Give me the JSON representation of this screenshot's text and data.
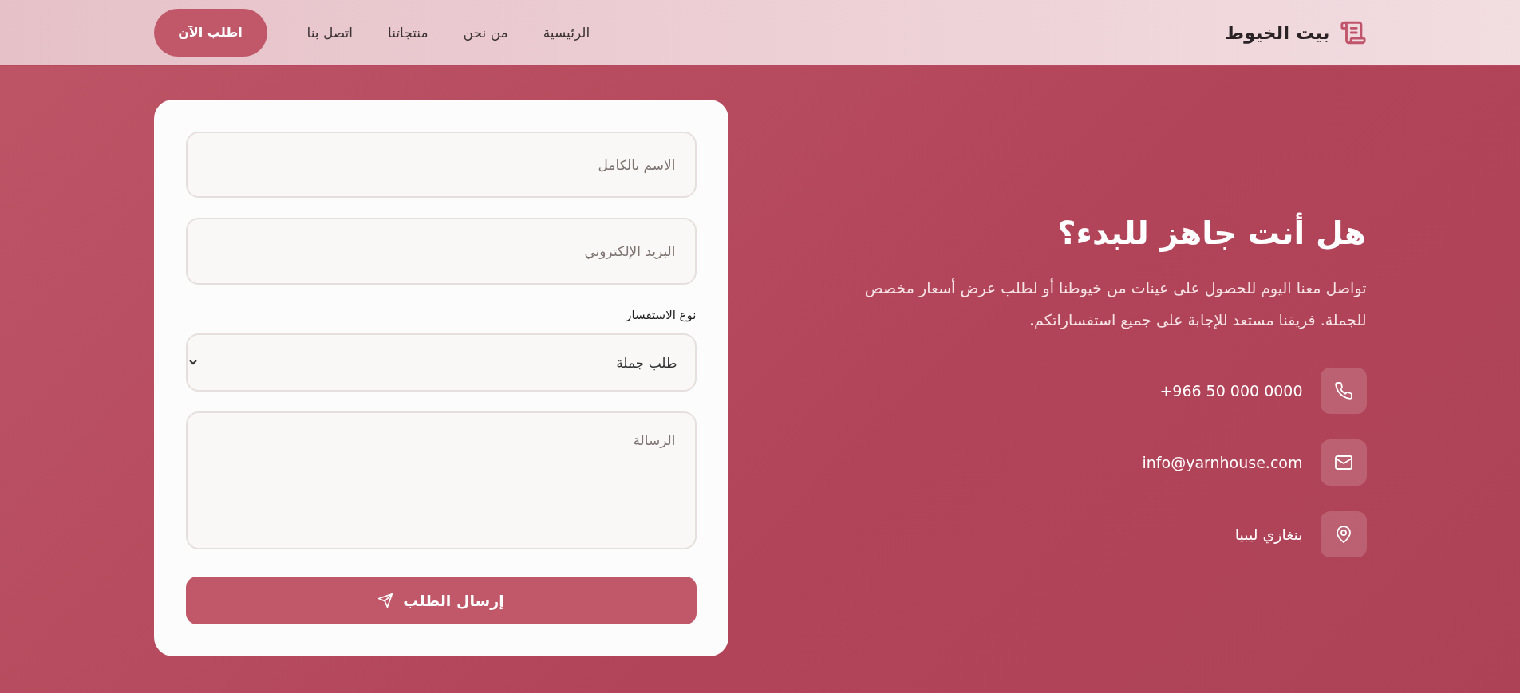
{
  "header": {
    "brand": "بيت الخيوط",
    "nav": [
      {
        "label": "الرئيسية"
      },
      {
        "label": "من نحن"
      },
      {
        "label": "منتجاتنا"
      },
      {
        "label": "اتصل بنا"
      }
    ],
    "cta": "اطلب الآن"
  },
  "intro": {
    "title": "هل أنت جاهز للبدء؟",
    "text": "تواصل معنا اليوم للحصول على عينات من خيوطنا أو لطلب عرض أسعار مخصص للجملة. فريقنا مستعد للإجابة على جميع استفساراتكم."
  },
  "contacts": [
    {
      "kind": "phone",
      "text": "+966 50 000 0000"
    },
    {
      "kind": "email",
      "text": "info@yarnhouse.com"
    },
    {
      "kind": "location",
      "text": "بنغازي ليبيا"
    }
  ],
  "form": {
    "name": {
      "placeholder": "الاسم بالكامل"
    },
    "email": {
      "placeholder": "البريد الإلكتروني"
    },
    "inquiry_label": "نوع الاستفسار",
    "inquiry": {
      "value": "طلب جملة"
    },
    "message": {
      "placeholder": "الرسالة"
    },
    "submit": "إرسال الطلب"
  }
}
